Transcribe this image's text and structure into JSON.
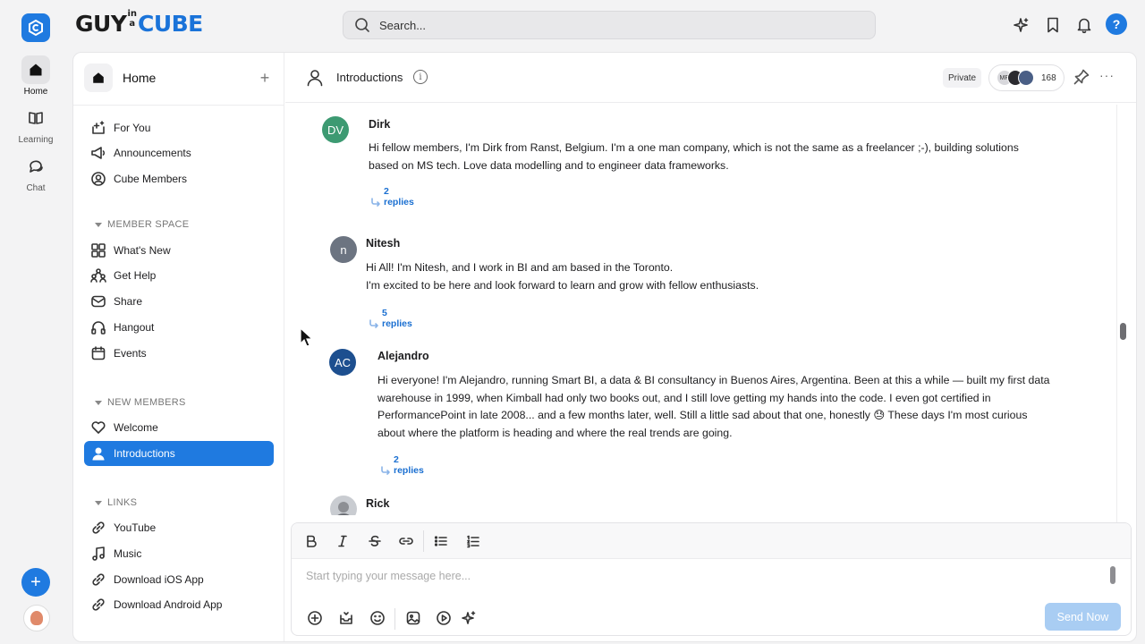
{
  "brand": {
    "part1": "GUY",
    "part2a": "in",
    "part2b": "a",
    "part3": "CUBE",
    "accent": "#1a73d9"
  },
  "search": {
    "placeholder": "Search..."
  },
  "topbar": {
    "help_label": "?"
  },
  "rail": {
    "items": [
      {
        "label": "Home",
        "icon": "home-icon"
      },
      {
        "label": "Learning",
        "icon": "book-icon"
      },
      {
        "label": "Chat",
        "icon": "chat-icon"
      }
    ],
    "add_label": "+"
  },
  "sidebar": {
    "title": "Home",
    "add_label": "+",
    "top_items": [
      {
        "label": "For You",
        "icon": "sparkle-icon"
      },
      {
        "label": "Announcements",
        "icon": "megaphone-icon"
      },
      {
        "label": "Cube Members",
        "icon": "user-circle-icon"
      }
    ],
    "sections": [
      {
        "label": "MEMBER SPACE",
        "items": [
          {
            "label": "What's New",
            "icon": "grid-icon"
          },
          {
            "label": "Get Help",
            "icon": "help-people-icon"
          },
          {
            "label": "Share",
            "icon": "envelope-icon"
          },
          {
            "label": "Hangout",
            "icon": "headphones-icon"
          },
          {
            "label": "Events",
            "icon": "calendar-icon"
          }
        ]
      },
      {
        "label": "NEW MEMBERS",
        "items": [
          {
            "label": "Welcome",
            "icon": "heart-icon"
          },
          {
            "label": "Introductions",
            "icon": "person-icon",
            "active": true
          }
        ]
      },
      {
        "label": "LINKS",
        "items": [
          {
            "label": "YouTube",
            "icon": "link-icon"
          },
          {
            "label": "Music",
            "icon": "music-icon"
          },
          {
            "label": "Download iOS App",
            "icon": "link-icon"
          },
          {
            "label": "Download Android App",
            "icon": "link-icon"
          }
        ]
      }
    ]
  },
  "channel": {
    "title": "Introductions",
    "privacy": "Private",
    "member_count": "168",
    "member_avatar_initials": "MR"
  },
  "messages": [
    {
      "initials": "DV",
      "avatar_color": "#3d9a72",
      "name": "Dirk",
      "lines": [
        "Hi fellow members, I'm Dirk from Ranst, Belgium. I'm a one man company, which is not the same as a freelancer ;-), building solutions",
        "based on MS tech. Love data modelling and to engineer data frameworks."
      ],
      "replies": "2 replies"
    },
    {
      "initials": "n",
      "avatar_color": "#6c7481",
      "name": "Nitesh",
      "lines": [
        "Hi All! I'm Nitesh, and I work in BI and am based in the Toronto.",
        "I'm excited to be here and look forward to learn and grow with fellow enthusiasts."
      ],
      "replies": "5 replies"
    },
    {
      "initials": "AC",
      "avatar_color": "#1d4f8f",
      "name": "Alejandro",
      "lines": [
        "Hi everyone! I'm Alejandro, running Smart BI, a data & BI consultancy in Buenos Aires, Argentina. Been at this a while — built my first data",
        "warehouse in 1999, when Kimball had only two books out, and I still love getting my hands into the code. I even got certified in",
        "PerformancePoint in late 2008... and a few months later, well. Still a little sad about that one, honestly 😓 These days I'm most curious",
        "about where the platform is heading and where the real trends are going."
      ],
      "replies": "2 replies"
    },
    {
      "initials": "",
      "avatar_color": "#9aa0a8",
      "name": "Rick",
      "lines": [],
      "replies": ""
    }
  ],
  "composer": {
    "placeholder": "Start typing your message here...",
    "send_label": "Send Now",
    "send_color": "#a9cdf3"
  }
}
